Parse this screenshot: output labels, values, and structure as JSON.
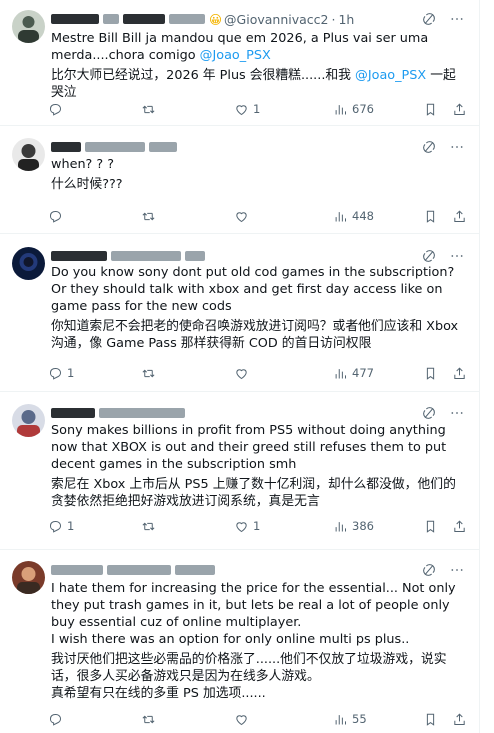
{
  "tweets": [
    {
      "handle": "@Giovannivacc2",
      "time": "1h",
      "text": "Mestre Bill Bill ja mandou que em 2026, a Plus vai ser uma merda....chora comigo ",
      "mention": "@Joao_PSX",
      "translation_a": "比尔大师已经说过，2026 年 Plus 会很糟糕......和我 ",
      "translation_mention": "@Joao_PSX",
      "translation_b": " 一起哭泣",
      "replies": "",
      "retweets": "",
      "likes": "1",
      "views": "676"
    },
    {
      "text": "when?  ?  ?",
      "translation": "什么时候???",
      "replies": "",
      "retweets": "",
      "likes": "",
      "views": "448"
    },
    {
      "text": "Do you know sony dont put old cod games in the subscription? Or they should talk with xbox and get first day access like on game pass for the new cods",
      "translation": "你知道索尼不会把老的使命召唤游戏放进订阅吗？或者他们应该和 Xbox 沟通，像 Game Pass 那样获得新 COD 的首日访问权限",
      "replies": "1",
      "retweets": "",
      "likes": "",
      "views": "477"
    },
    {
      "text": "Sony makes billions in profit from PS5 without doing anything now that XBOX is out and their greed still refuses them to put decent games in the subscription smh",
      "translation": "索尼在 Xbox 上市后从 PS5 上赚了数十亿利润，却什么都没做，他们的贪婪依然拒绝把好游戏放进订阅系统，真是无言",
      "replies": "1",
      "retweets": "",
      "likes": "1",
      "views": "386"
    },
    {
      "text": "I hate them for increasing the price for the essential... Not only they put trash games in it, but lets be real a lot of people only buy essential cuz of online multiplayer.",
      "text2": "I wish there was an option for only online multi ps plus..",
      "translation": "我讨厌他们把这些必需品的价格涨了......他们不仅放了垃圾游戏，说实话，很多人买必备游戏只是因为在线多人游戏。",
      "translation2": "真希望有只在线的多重 PS 加选项......",
      "replies": "",
      "retweets": "",
      "likes": "",
      "views": "55"
    }
  ],
  "colors": {
    "text": "#0f1419",
    "muted": "#536471",
    "link": "#1d9bf0",
    "divider": "#eff3f4"
  },
  "icons": [
    "grok-icon",
    "more-icon",
    "reply-icon",
    "retweet-icon",
    "like-icon",
    "views-icon",
    "bookmark-icon",
    "share-icon"
  ]
}
